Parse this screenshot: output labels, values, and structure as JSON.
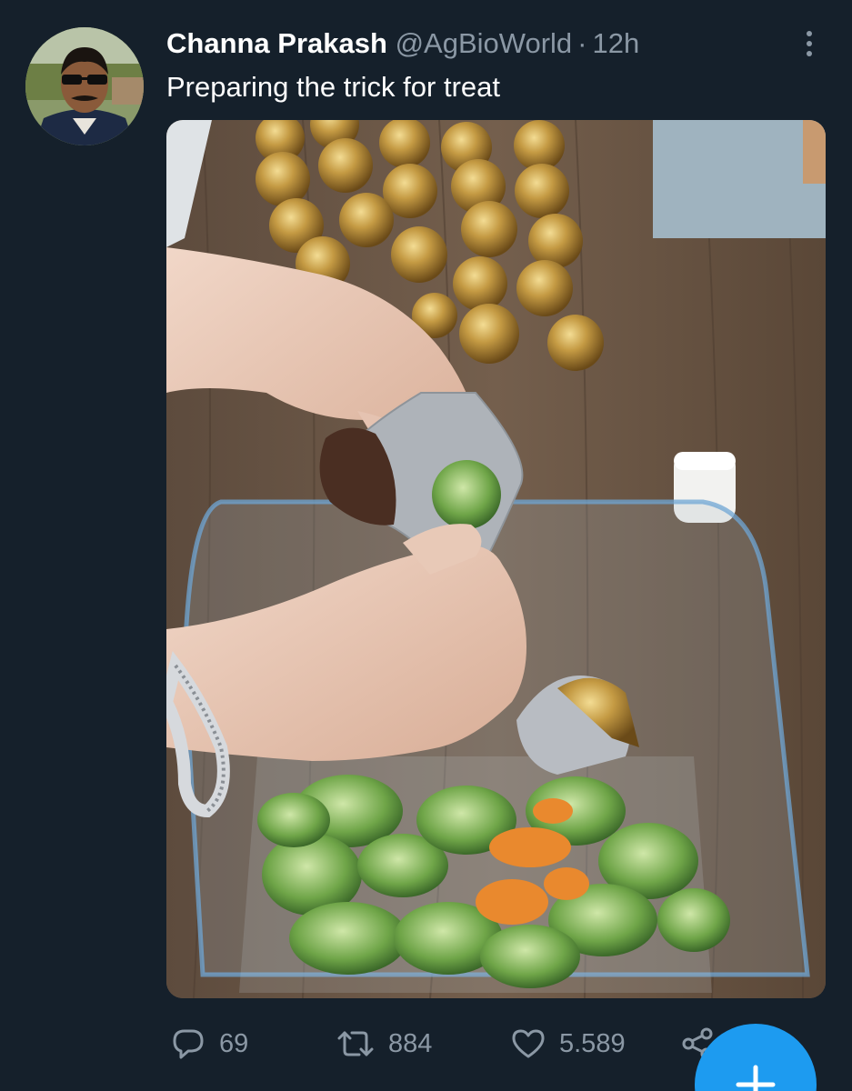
{
  "tweet": {
    "display_name": "Channa Prakash",
    "handle": "@AgBioWorld",
    "separator": "·",
    "time": "12h",
    "text": "Preparing the trick for treat"
  },
  "actions": {
    "replies": "69",
    "retweets": "884",
    "likes": "5.589"
  },
  "icons": {
    "more": "more-vertical-icon",
    "reply": "speech-bubble-icon",
    "retweet": "retweet-arrows-icon",
    "like": "heart-icon",
    "share": "share-icon",
    "compose": "plus-icon"
  },
  "colors": {
    "background": "#15202b",
    "secondary_text": "#8b98a5",
    "accent": "#1d9bf0"
  }
}
